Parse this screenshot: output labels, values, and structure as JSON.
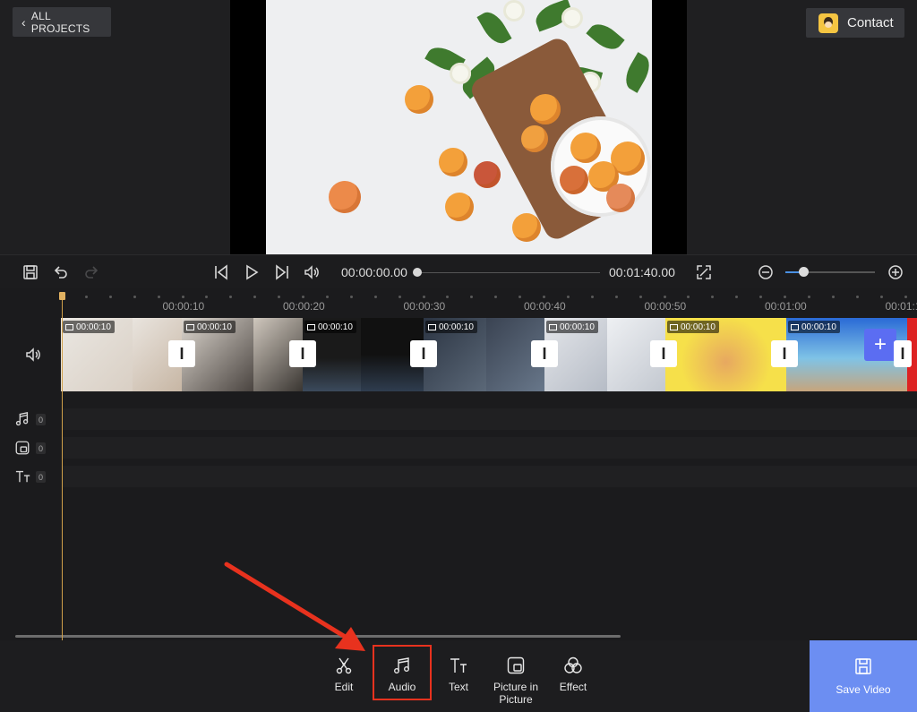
{
  "header": {
    "back_label": "ALL PROJECTS",
    "contact_label": "Contact"
  },
  "player": {
    "current_time": "00:00:00.00",
    "total_time": "00:01:40.00",
    "seek_progress": 0.0,
    "zoom_level": 0.2
  },
  "timeline": {
    "ruler_labels": [
      "00:00:10",
      "00:00:20",
      "00:00:30",
      "00:00:40",
      "00:00:50",
      "00:01:00",
      "00:01:1"
    ],
    "clips": [
      {
        "duration": "00:00:10"
      },
      {
        "duration": "00:00:10"
      },
      {
        "duration": "00:00:10"
      },
      {
        "duration": "00:00:10"
      },
      {
        "duration": "00:00:10"
      },
      {
        "duration": "00:00:10"
      },
      {
        "duration": "00:00:10"
      }
    ],
    "tracks": {
      "audio_count": "0",
      "pip_count": "0",
      "text_count": "0"
    }
  },
  "toolbar": {
    "edit_label": "Edit",
    "audio_label": "Audio",
    "text_label": "Text",
    "pip_label": "Picture in Picture",
    "effect_label": "Effect",
    "save_label": "Save Video"
  },
  "colors": {
    "accent": "#6c8ef2",
    "highlight": "#e8321e",
    "playhead": "#d0a04a"
  }
}
